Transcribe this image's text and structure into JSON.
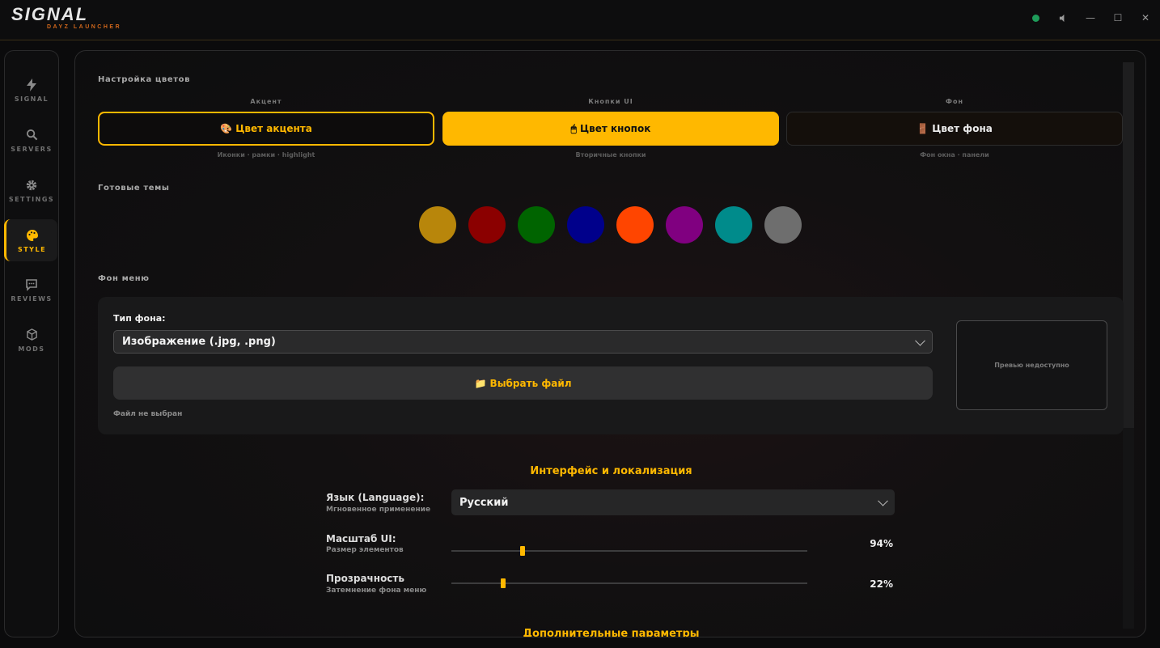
{
  "app": {
    "logo_main": "SIGNAL",
    "logo_sub": "DAYZ LAUNCHER"
  },
  "window_controls": {
    "minimize": "—",
    "maximize": "☐",
    "close": "✕"
  },
  "sidebar": {
    "items": [
      {
        "label": "SIGNAL",
        "icon": "bolt-icon",
        "active": false
      },
      {
        "label": "SERVERS",
        "icon": "search-icon",
        "active": false
      },
      {
        "label": "SETTINGS",
        "icon": "gear-icon",
        "active": false
      },
      {
        "label": "STYLE",
        "icon": "palette-icon",
        "active": true
      },
      {
        "label": "REVIEWS",
        "icon": "chat-icon",
        "active": false
      },
      {
        "label": "MODS",
        "icon": "cube-icon",
        "active": false
      }
    ]
  },
  "colors_section": {
    "title": "Настройка цветов",
    "columns": [
      {
        "label": "Акцент",
        "button": "🎨 Цвет акцента",
        "hint": "Иконки · рамки · highlight"
      },
      {
        "label": "Кнопки UI",
        "button": "🖱 Цвет кнопок",
        "hint": "Вторичные кнопки"
      },
      {
        "label": "Фон",
        "button": "🚪 Цвет фона",
        "hint": "Фон окна · панели"
      }
    ]
  },
  "themes": {
    "title": "Готовые темы",
    "swatches": [
      "#b8860b",
      "#8b0000",
      "#006400",
      "#00008b",
      "#ff4500",
      "#800080",
      "#008b8b",
      "#6e6e6e"
    ]
  },
  "menu_bg": {
    "title": "Фон меню",
    "type_label": "Тип фона:",
    "type_value": "Изображение (.jpg, .png)",
    "file_button": "📁 Выбрать файл",
    "file_status": "Файл не выбран",
    "preview": "Превью недоступно"
  },
  "interface": {
    "heading": "Интерфейс и локализация",
    "language": {
      "label": "Язык (Language):",
      "sub": "Мгновенное применение",
      "value": "Русский"
    },
    "scale": {
      "label": "Масштаб UI:",
      "sub": "Размер элементов",
      "value": "94%",
      "level": 0.2
    },
    "opacity": {
      "label": "Прозрачность",
      "sub": "Затемнение фона меню",
      "value": "22%",
      "level": 0.146
    },
    "next_heading": "Дополнительные параметры"
  },
  "accent_color": "#ffb800"
}
